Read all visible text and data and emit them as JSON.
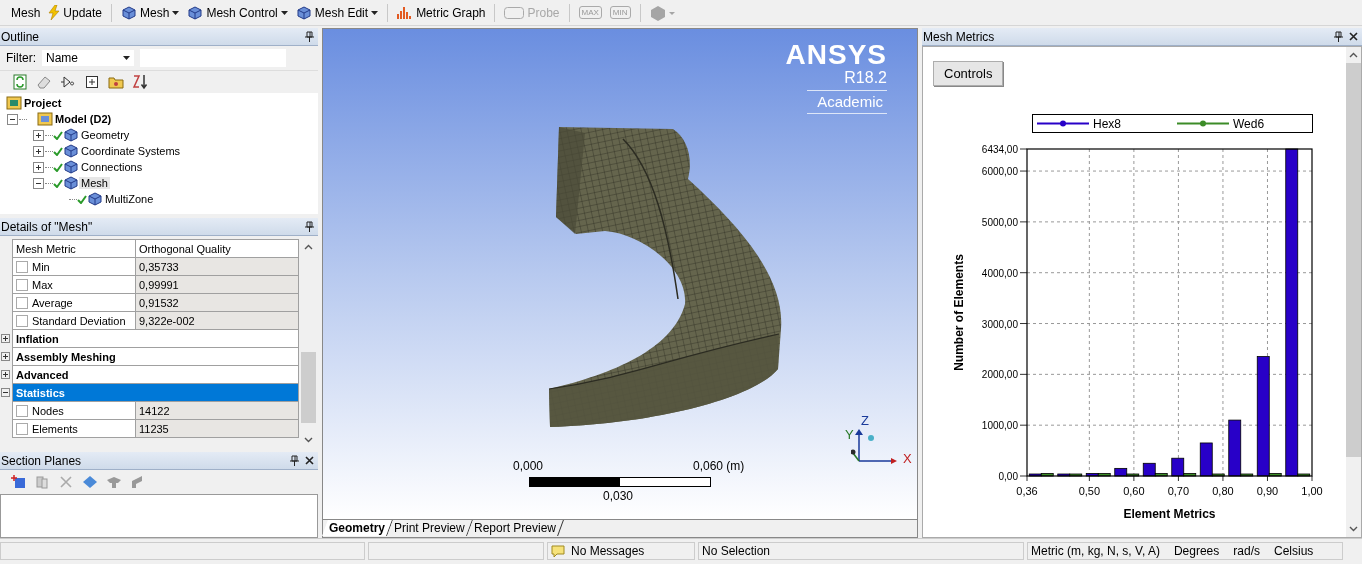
{
  "toolbar": {
    "groups": [
      [
        {
          "label": "Mesh",
          "kind": "menu",
          "disabled": false
        },
        {
          "label": "Update",
          "kind": "update",
          "disabled": false
        }
      ],
      [
        {
          "label": "Mesh",
          "kind": "dropdown",
          "disabled": false
        },
        {
          "label": "Mesh Control",
          "kind": "dropdown",
          "disabled": false
        },
        {
          "label": "Mesh Edit",
          "kind": "dropdown",
          "disabled": false
        }
      ],
      [
        {
          "label": "Metric Graph",
          "kind": "graph",
          "disabled": false
        }
      ],
      [
        {
          "label": "Probe",
          "kind": "probe",
          "disabled": true
        }
      ],
      [
        {
          "label": "MAX",
          "kind": "small",
          "disabled": true
        },
        {
          "label": "MIN",
          "kind": "small",
          "disabled": true
        }
      ],
      [
        {
          "kind": "shape",
          "disabled": true
        }
      ]
    ]
  },
  "outline": {
    "title": "Outline",
    "filter": {
      "label": "Filter:",
      "value": "Name"
    },
    "tree": [
      {
        "label": "Project",
        "selected": false,
        "children": [
          {
            "label": "Model (D2)",
            "selected": false,
            "expanded": true,
            "children": [
              {
                "label": "Geometry",
                "ok": true,
                "selected": false,
                "expanded": false
              },
              {
                "label": "Coordinate Systems",
                "ok": true,
                "selected": false,
                "expanded": false
              },
              {
                "label": "Connections",
                "ok": true,
                "selected": false,
                "expanded": false
              },
              {
                "label": "Mesh",
                "ok": true,
                "selected": true,
                "expanded": true,
                "children": [
                  {
                    "label": "MultiZone",
                    "ok": true,
                    "selected": false
                  }
                ]
              }
            ]
          }
        ]
      }
    ]
  },
  "details": {
    "title": "Details of \"Mesh\"",
    "rows": [
      {
        "kind": "header",
        "label": "Mesh Metric",
        "value": "Orthogonal Quality"
      },
      {
        "kind": "item",
        "label": "Min",
        "value": "0,35733",
        "checked": false
      },
      {
        "kind": "item",
        "label": "Max",
        "value": "0,99991",
        "checked": false
      },
      {
        "kind": "item",
        "label": "Average",
        "value": "0,91532",
        "checked": false
      },
      {
        "kind": "item",
        "label": "Standard Deviation",
        "value": "9,322e-002",
        "checked": false
      },
      {
        "kind": "group",
        "label": "Inflation",
        "expanded": false,
        "selected": false
      },
      {
        "kind": "group",
        "label": "Assembly Meshing",
        "expanded": false,
        "selected": false
      },
      {
        "kind": "group",
        "label": "Advanced",
        "expanded": false,
        "selected": false
      },
      {
        "kind": "group",
        "label": "Statistics",
        "expanded": true,
        "selected": true
      },
      {
        "kind": "item",
        "label": "Nodes",
        "value": "14122",
        "checked": false
      },
      {
        "kind": "item",
        "label": "Elements",
        "value": "11235",
        "checked": false
      }
    ]
  },
  "section_planes": {
    "title": "Section Planes"
  },
  "viewport": {
    "logo": {
      "name": "ANSYS",
      "version": "R18.2",
      "edition": "Academic"
    },
    "scale": {
      "start": "0,000",
      "end": "0,060 (m)",
      "mid": "0,030"
    },
    "triad": {
      "x": "X",
      "y": "Y",
      "z": "Z"
    },
    "tabs": [
      {
        "label": "Geometry",
        "selected": true
      },
      {
        "label": "Print Preview",
        "selected": false
      },
      {
        "label": "Report Preview",
        "selected": false
      }
    ]
  },
  "metrics": {
    "title": "Mesh Metrics",
    "button": "Controls",
    "chart_data": {
      "type": "bar",
      "xlabel": "Element Metrics",
      "ylabel": "Number of Elements",
      "x": [
        0.392,
        0.456,
        0.52,
        0.584,
        0.648,
        0.712,
        0.776,
        0.84,
        0.904,
        0.968
      ],
      "series": [
        {
          "name": "Hex8",
          "color": "#2800c8",
          "values": [
            0,
            0,
            50,
            150,
            250,
            350,
            650,
            1100,
            2350,
            6434
          ]
        },
        {
          "name": "Wed6",
          "color": "#3c8c28",
          "values": [
            50,
            0,
            50,
            0,
            50,
            50,
            0,
            0,
            50,
            0
          ]
        }
      ],
      "xlim": [
        0.36,
        1.0
      ],
      "ylim": [
        0,
        6434
      ],
      "xticks": [
        {
          "value": 0.36,
          "label": "0,36"
        },
        {
          "value": 0.5,
          "label": "0,50"
        },
        {
          "value": 0.6,
          "label": "0,60"
        },
        {
          "value": 0.7,
          "label": "0,70"
        },
        {
          "value": 0.8,
          "label": "0,80"
        },
        {
          "value": 0.9,
          "label": "0,90"
        },
        {
          "value": 1.0,
          "label": "1,00"
        }
      ],
      "yticks": [
        {
          "value": 0,
          "label": "0,00"
        },
        {
          "value": 1000,
          "label": "1000,00"
        },
        {
          "value": 2000,
          "label": "2000,00"
        },
        {
          "value": 3000,
          "label": "3000,00"
        },
        {
          "value": 4000,
          "label": "4000,00"
        },
        {
          "value": 5000,
          "label": "5000,00"
        },
        {
          "value": 6000,
          "label": "6000,00"
        },
        {
          "value": 6434,
          "label": "6434,00"
        }
      ],
      "grid": true,
      "legend": true
    }
  },
  "status_bar": {
    "messages": "No Messages",
    "selection": "No Selection",
    "units": [
      "Metric (m, kg, N, s, V, A)",
      "Degrees",
      "rad/s",
      "Celsius"
    ]
  }
}
